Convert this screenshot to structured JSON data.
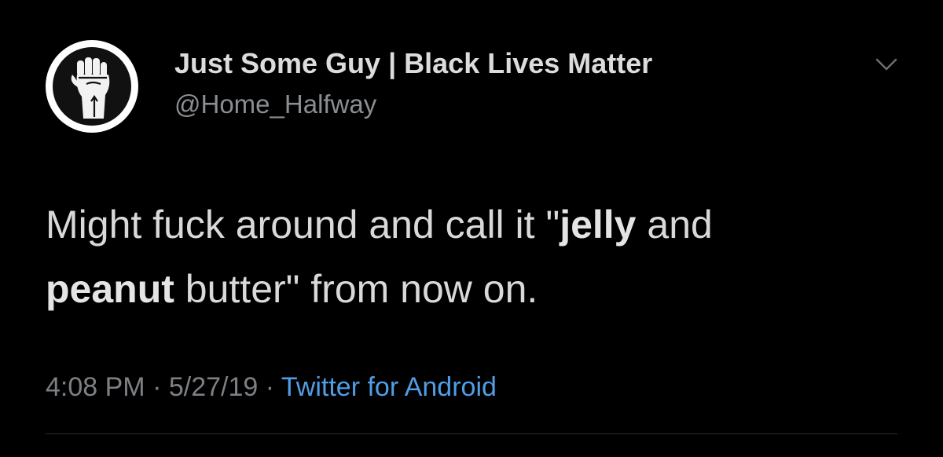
{
  "tweet": {
    "author": {
      "display_name": "Just Some Guy | Black Lives Matter",
      "handle": "@Home_Halfway",
      "avatar_icon": "raised-fist-icon"
    },
    "menu_icon": "chevron-down-icon",
    "text": {
      "w1": "Might fuck around and call it \"",
      "w2": "jelly",
      "w3": " and",
      "w4": "peanut",
      "w5": " butter\" from now on."
    },
    "meta": {
      "time": "4:08 PM",
      "sep1": " · ",
      "date": "5/27/19",
      "sep2": " · ",
      "source": "Twitter for Android"
    }
  },
  "colors": {
    "background": "#000000",
    "text": "#d9d9d9",
    "muted": "#8a8d91",
    "link": "#4f9ee6"
  }
}
